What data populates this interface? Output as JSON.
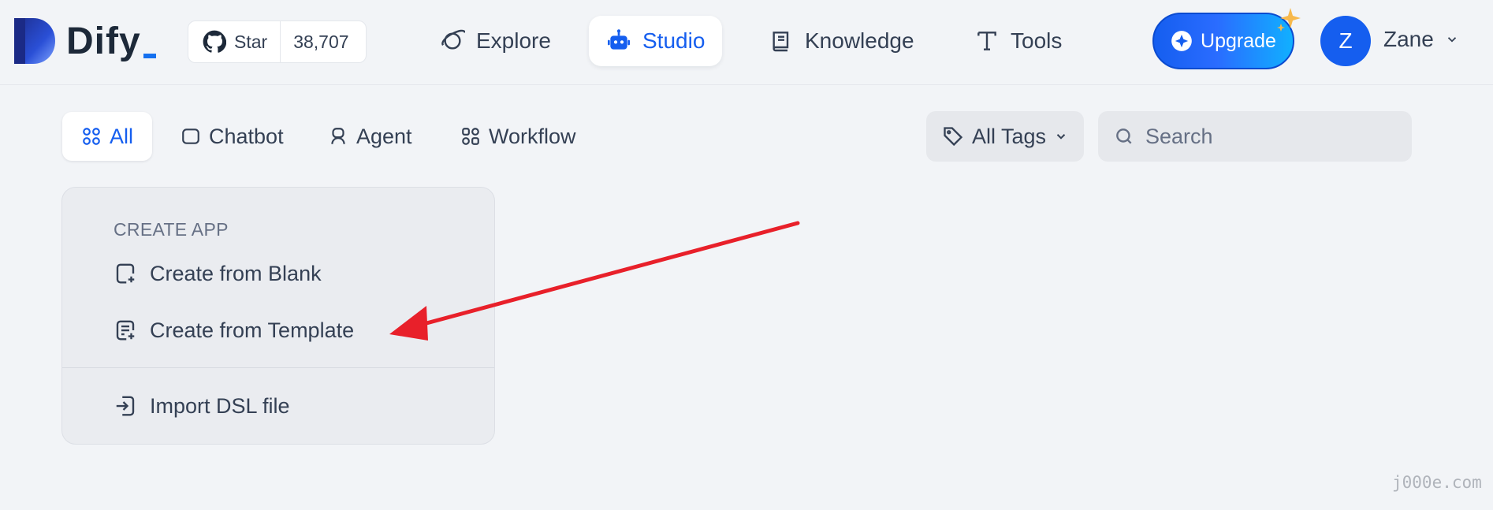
{
  "brand": {
    "name": "Dify",
    "accent": "#155eef"
  },
  "github": {
    "star_label": "Star",
    "count": "38,707"
  },
  "nav": {
    "explore": "Explore",
    "studio": "Studio",
    "knowledge": "Knowledge",
    "tools": "Tools"
  },
  "upgrade_label": "Upgrade",
  "user": {
    "initial": "Z",
    "name": "Zane"
  },
  "filters": {
    "tabs": [
      "All",
      "Chatbot",
      "Agent",
      "Workflow"
    ],
    "active_tab": "All",
    "tags_label": "All Tags",
    "search_placeholder": "Search"
  },
  "create_app": {
    "title": "CREATE APP",
    "blank": "Create from Blank",
    "template": "Create from Template",
    "import_dsl": "Import DSL file"
  },
  "annotation_color": "#e8202a",
  "watermark": "j000e.com"
}
